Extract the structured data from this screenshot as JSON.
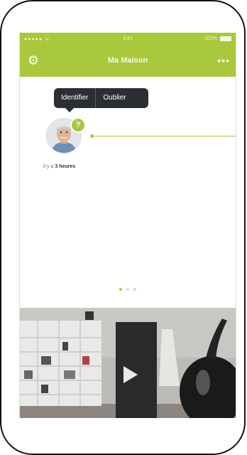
{
  "status_bar": {
    "signal": "●●●●● ᯤ",
    "time": "9:41",
    "battery_text": "100%"
  },
  "nav": {
    "title": "Ma Maison",
    "settings_icon": "gear-icon",
    "more_icon": "more-icon"
  },
  "tooltip": {
    "identify_label": "Identifier",
    "forget_label": "Oublier"
  },
  "event": {
    "badge": "?",
    "time_prefix": "il y a",
    "time_value": "3 heures"
  },
  "pagination": {
    "count": 3,
    "active": 0
  },
  "colors": {
    "accent": "#a9c83b",
    "tooltip_bg": "#2b2f33"
  }
}
